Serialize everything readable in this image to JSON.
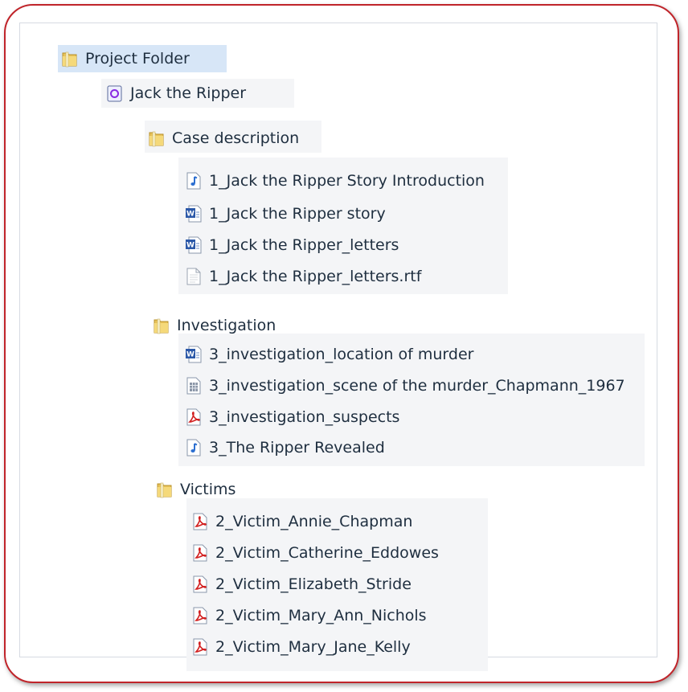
{
  "tree": {
    "root": {
      "label": "Project Folder",
      "icon": "folder-icon"
    },
    "project": {
      "label": "Jack the Ripper",
      "icon": "project-file-icon"
    },
    "groups": [
      {
        "label": "Case description",
        "icon": "folder-icon",
        "files": [
          {
            "label": "1_Jack the Ripper Story Introduction",
            "icon": "audio-file-icon"
          },
          {
            "label": "1_Jack the Ripper story",
            "icon": "word-document-icon"
          },
          {
            "label": "1_Jack the Ripper_letters",
            "icon": "word-document-icon"
          },
          {
            "label": "1_Jack the Ripper_letters.rtf",
            "icon": "text-file-icon"
          }
        ]
      },
      {
        "label": "Investigation",
        "icon": "folder-icon",
        "files": [
          {
            "label": "3_investigation_location of murder",
            "icon": "word-document-icon"
          },
          {
            "label": "3_investigation_scene of the murder_Chapmann_1967",
            "icon": "spreadsheet-file-icon"
          },
          {
            "label": "3_investigation_suspects",
            "icon": "pdf-file-icon"
          },
          {
            "label": "3_The Ripper Revealed",
            "icon": "audio-file-icon"
          }
        ]
      },
      {
        "label": "Victims",
        "icon": "folder-icon",
        "files": [
          {
            "label": "2_Victim_Annie_Chapman",
            "icon": "pdf-file-icon"
          },
          {
            "label": "2_Victim_Catherine_Eddowes",
            "icon": "pdf-file-icon"
          },
          {
            "label": "2_Victim_Elizabeth_Stride",
            "icon": "pdf-file-icon"
          },
          {
            "label": "2_Victim_Mary_Ann_Nichols",
            "icon": "pdf-file-icon"
          },
          {
            "label": "2_Victim_Mary_Jane_Kelly",
            "icon": "pdf-file-icon"
          }
        ]
      }
    ]
  },
  "colors": {
    "frame_border": "#c0242a",
    "selection": "#d7e6f7",
    "text": "#1e2e3f"
  }
}
